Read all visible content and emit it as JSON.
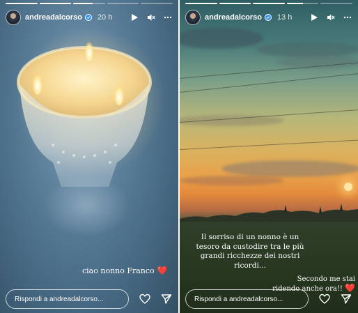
{
  "stories": [
    {
      "username": "andreadalcorso",
      "time": "20 h",
      "progress": [
        1,
        1,
        0.6,
        0,
        0
      ],
      "caption": "ciao nonno Franco",
      "caption_emoji": "❤️",
      "reply_placeholder": "Rispondi a andreadalcorso...",
      "icons": [
        "play-icon",
        "mute-icon",
        "more-icon",
        "heart-icon",
        "send-icon"
      ]
    },
    {
      "username": "andreadalcorso",
      "time": "13 h",
      "progress": [
        1,
        1,
        1,
        0.5,
        0
      ],
      "caption": "Il sorriso di un nonno è un tesoro da custodire tra le più grandi ricchezze dei nostri ricordi...",
      "caption2": "Secondo me stai ridendo anche ora!!",
      "caption2_emoji": "❤️",
      "reply_placeholder": "Rispondi a andreadalcorso...",
      "icons": [
        "play-icon",
        "mute-icon",
        "more-icon",
        "heart-icon",
        "send-icon"
      ]
    }
  ],
  "colors": {
    "heart": "#e0302e",
    "text": "#ffffff"
  }
}
